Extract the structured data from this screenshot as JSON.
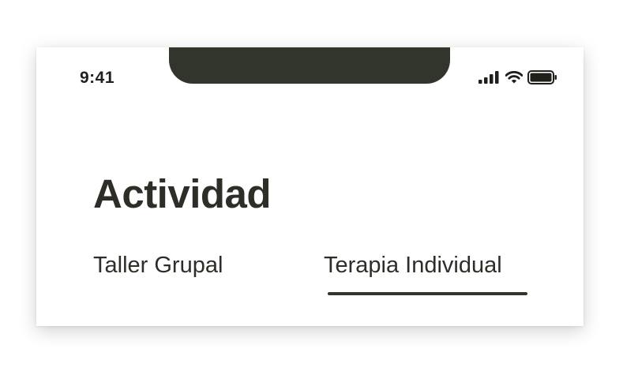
{
  "status_bar": {
    "time": "9:41",
    "icons": [
      "cellular-signal-icon",
      "wifi-icon",
      "battery-icon"
    ]
  },
  "page": {
    "title": "Actividad"
  },
  "tabs": [
    {
      "label": "Taller Grupal",
      "selected": false
    },
    {
      "label": "Terapia Individual",
      "selected": true
    }
  ],
  "colors": {
    "accent": "#32352c",
    "text": "#2c2e27",
    "background": "#ffffff"
  }
}
